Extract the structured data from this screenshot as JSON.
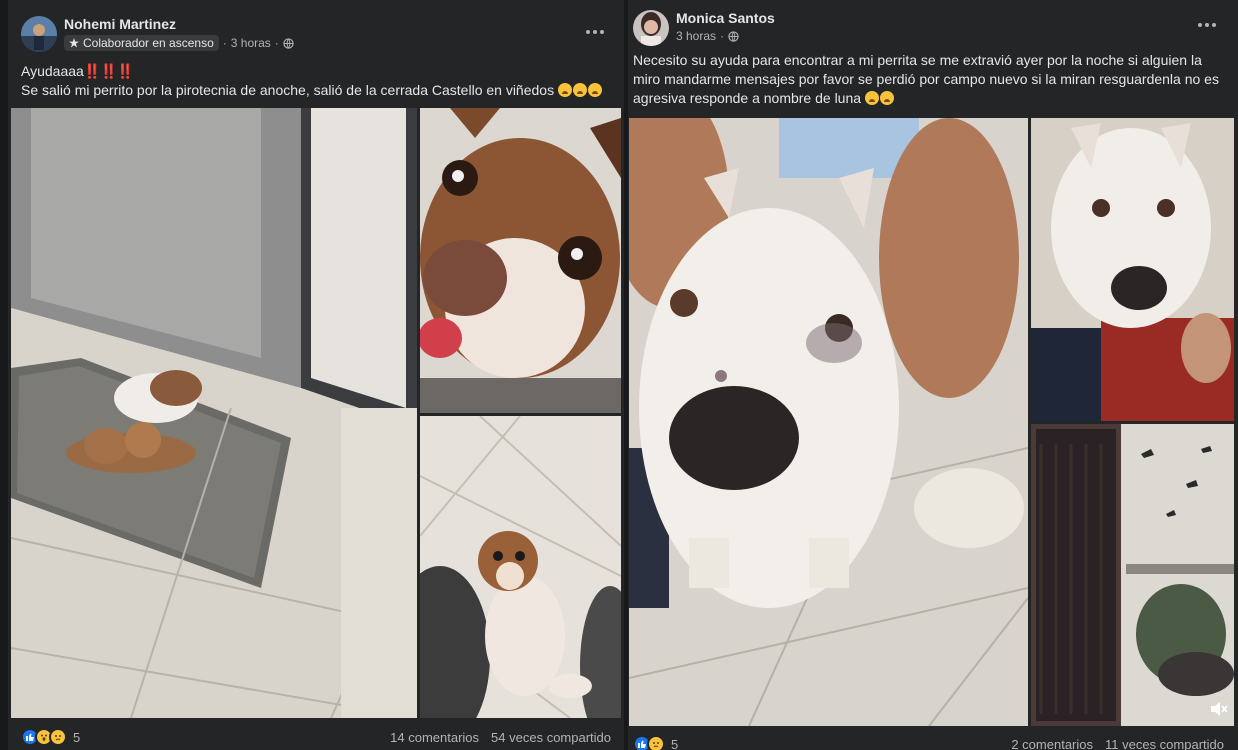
{
  "posts": [
    {
      "author": "Nohemi Martinez",
      "badge": "Colaborador en ascenso",
      "time": "3 horas",
      "line1": "Ayudaaaa",
      "line1_marks": "‼️‼️‼️",
      "line2": "Se salió mi perrito por la pirotecnia de anoche, salió de la cerrada Castello en viñedos",
      "reactions_count": "5",
      "comments": "14 comentarios",
      "shares": "54 veces compartido",
      "photos": [
        "chihuahuas-on-rug",
        "chihuahua-closeup",
        "chihuahua-standing"
      ]
    },
    {
      "author": "Monica Santos",
      "time": "3 horas",
      "text": "Necesito su ayuda para encontrar a mi perrita se me extravió ayer por la noche si alguien la miro mandarme mensajes por favor se perdió por campo nuevo si la miran resguardenla no es agresiva responde a nombre de luna",
      "reactions_count": "5",
      "comments": "2 comentarios",
      "shares": "11 veces compartido",
      "photos": [
        "white-dog-closeup",
        "white-dog-lap",
        "video-room"
      ]
    }
  ],
  "colors": {
    "background": "#18191a",
    "card": "#242526",
    "text_primary": "#e4e6eb",
    "text_secondary": "#b0b3b8",
    "like_blue": "#1877f2"
  }
}
